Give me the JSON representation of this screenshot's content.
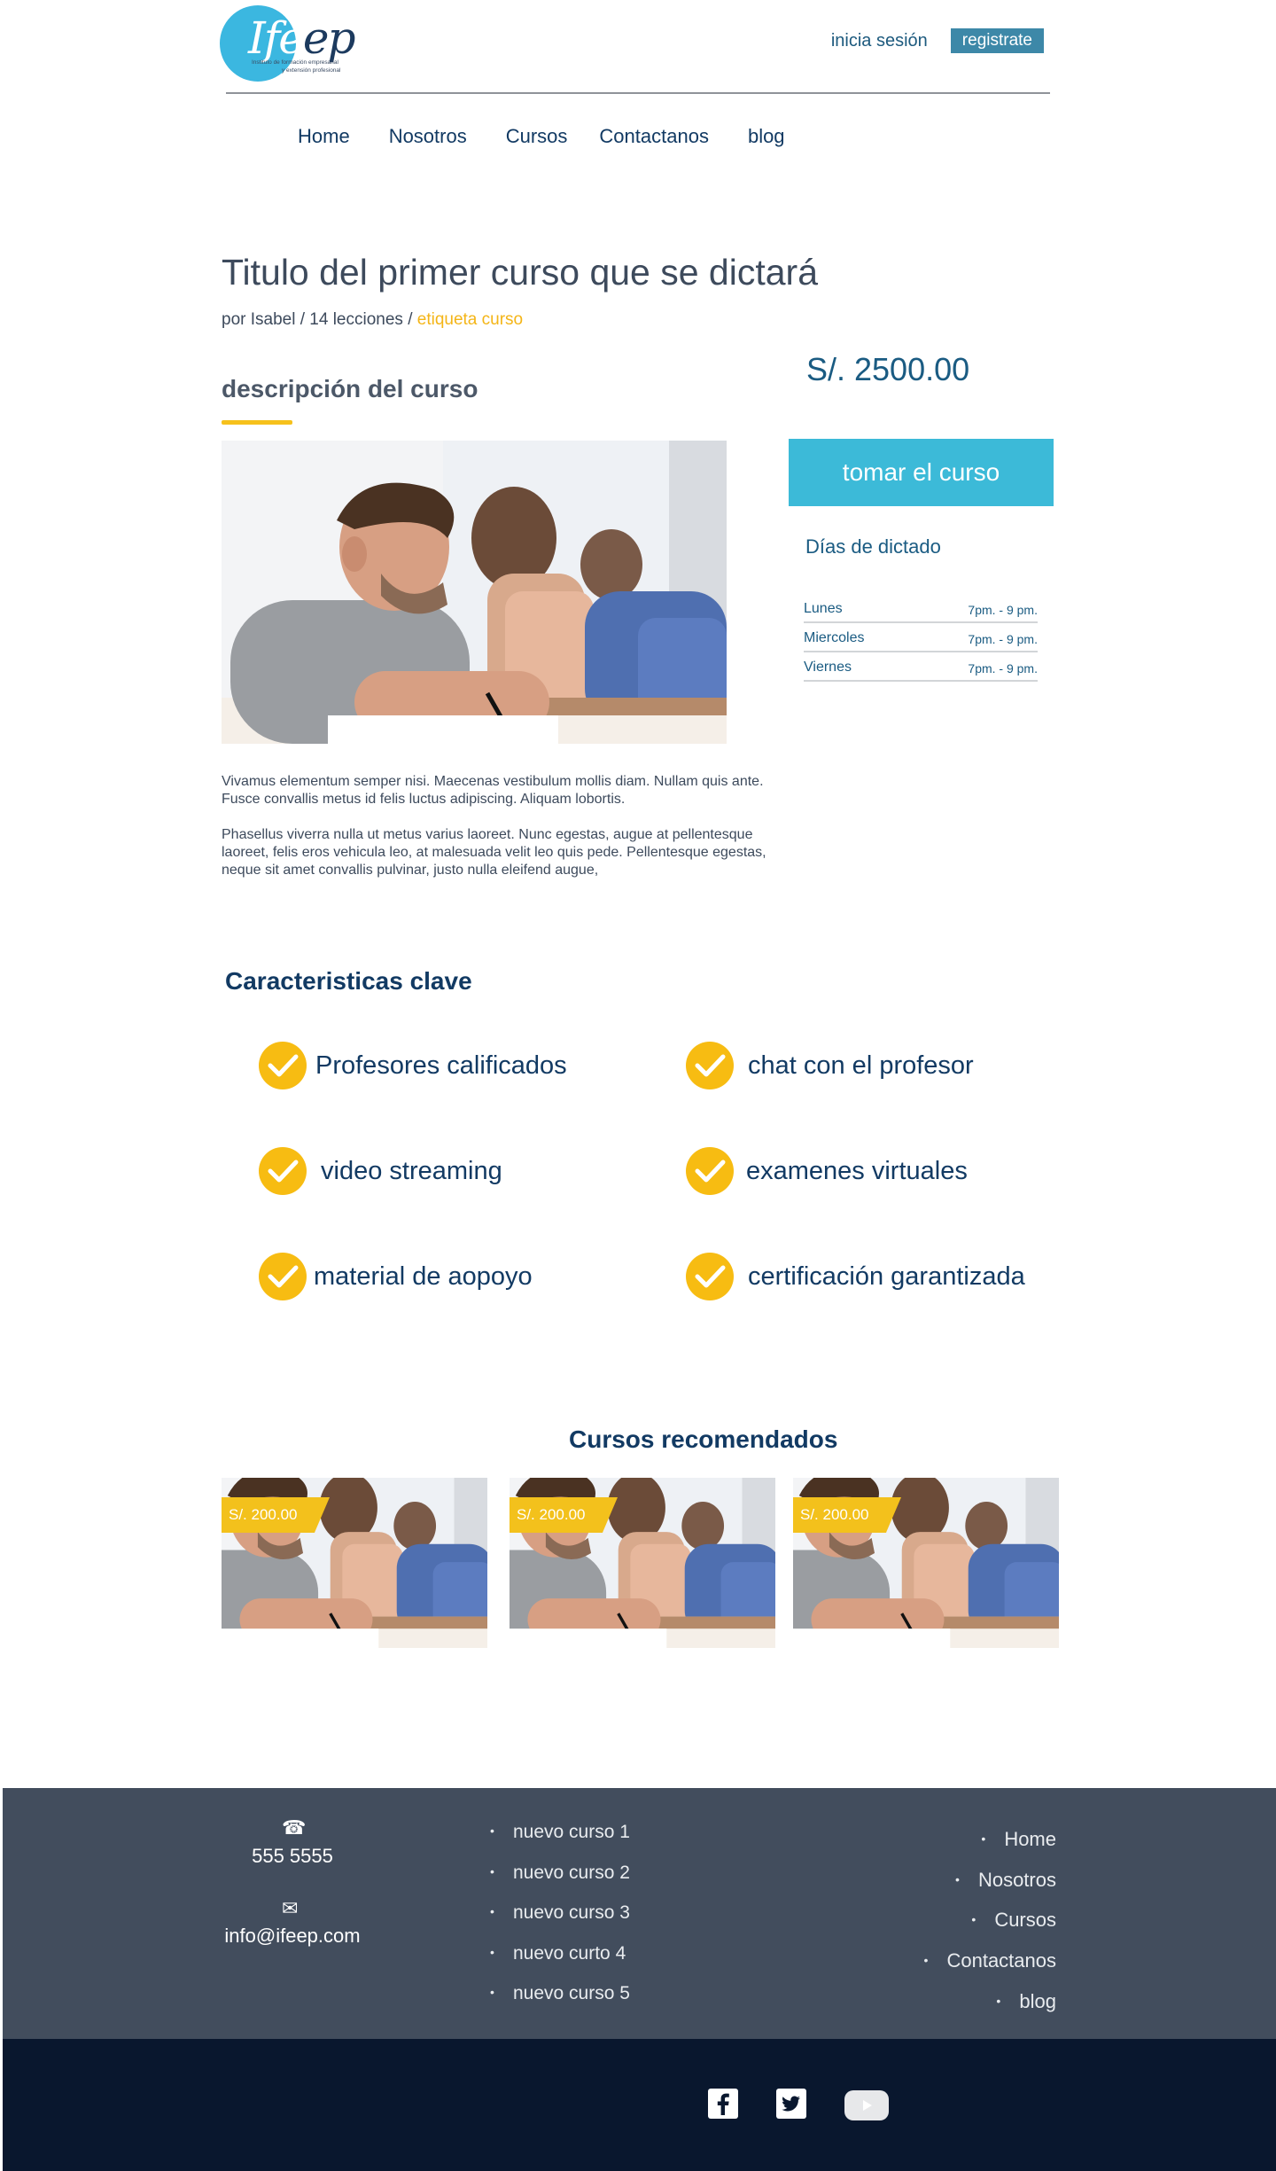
{
  "header": {
    "logo_text_light": "Ife",
    "logo_text_dark": "ep",
    "logo_sub_1": "Instituto de formación empresarial",
    "logo_sub_2": "y extensión profesional",
    "login_label": "inicia sesión",
    "register_label": "registrate"
  },
  "nav": {
    "items": [
      "Home",
      "Nosotros",
      "Cursos",
      "Contactanos",
      "blog"
    ]
  },
  "course": {
    "title": "Titulo del primer curso que se dictará",
    "meta_author": "por Isabel",
    "meta_lessons": "14 lecciones",
    "meta_sep": " / ",
    "meta_tag": "etiqueta curso",
    "description_heading": "descripción del curso",
    "paragraph_1": "Vivamus elementum semper nisi. Maecenas vestibulum mollis diam. Nullam quis ante. Fusce convallis metus id felis luctus adipiscing. Aliquam lobortis.",
    "paragraph_2": "Phasellus viverra nulla ut metus varius laoreet. Nunc egestas, augue at pellentesque laoreet, felis eros vehicula leo, at malesuada velit leo quis pede. Pellentesque egestas, neque sit amet convallis pulvinar, justo nulla eleifend augue,"
  },
  "sidebar": {
    "price": "S/. 2500.00",
    "cta_label": "tomar el curso",
    "schedule_title": "Días de dictado",
    "schedule": [
      {
        "day": "Lunes",
        "time": "7pm. - 9 pm."
      },
      {
        "day": "Miercoles",
        "time": "7pm. - 9 pm."
      },
      {
        "day": "Viernes",
        "time": "7pm. - 9 pm."
      }
    ]
  },
  "features": {
    "title": "Caracteristicas clave",
    "items": [
      "Profesores calificados",
      "chat con el profesor",
      "video streaming",
      "examenes virtuales",
      "material de aopoyo",
      "certificación garantizada"
    ]
  },
  "recommended": {
    "title": "Cursos recomendados",
    "cards": [
      {
        "price": "S/. 200.00"
      },
      {
        "price": "S/. 200.00"
      },
      {
        "price": "S/. 200.00"
      }
    ]
  },
  "footer": {
    "phone": "555  5555",
    "email": "info@ifeep.com",
    "courses": [
      "nuevo curso 1",
      "nuevo curso 2",
      "nuevo curso 3",
      "nuevo curto 4",
      "nuevo curso 5"
    ],
    "nav": [
      "Home",
      "Nosotros",
      "Cursos",
      "Contactanos",
      "blog"
    ],
    "icons": [
      "phone-icon",
      "mail-icon"
    ],
    "social": [
      "facebook-icon",
      "twitter-icon",
      "youtube-icon"
    ]
  },
  "colors": {
    "accent_blue": "#3cbad8",
    "accent_yellow": "#f7bc12",
    "navy": "#123a63",
    "footer_bg": "#424d5d",
    "bottom_bar_bg": "#09172e"
  }
}
